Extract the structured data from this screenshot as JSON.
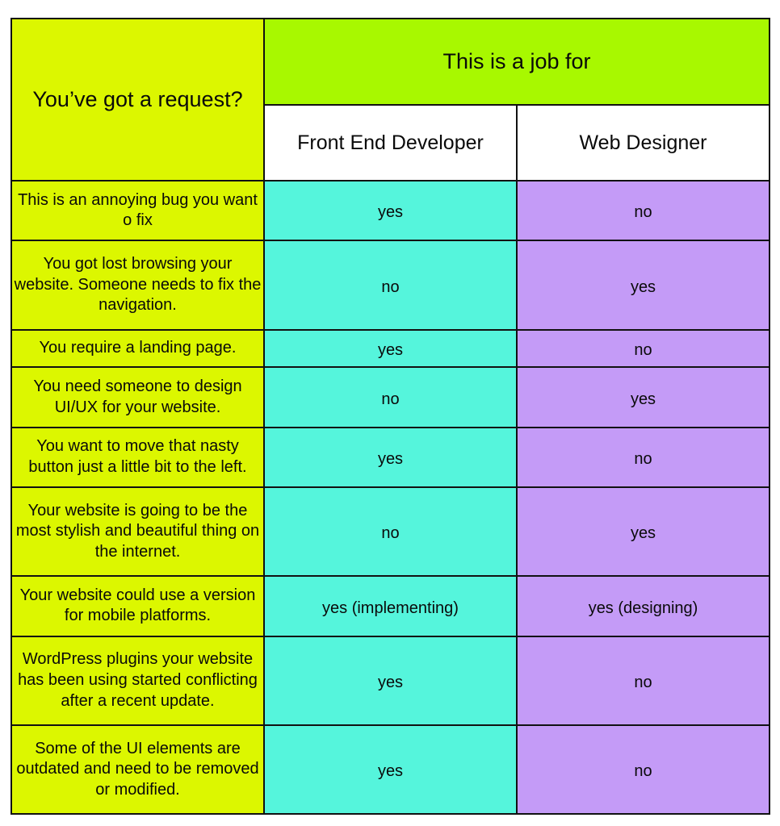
{
  "colors": {
    "request_header_bg": "#DCF700",
    "jobfor_header_bg": "#A8F800",
    "role_header_bg": "#FFFFFF",
    "request_cell_bg": "#DCF700",
    "front_end_cell_bg": "#55F5DC",
    "web_designer_cell_bg": "#C49BF7",
    "border": "#111111",
    "body_text": "#0A0A0A",
    "role_header_text": "#555555",
    "page_bg": "#FFFFFF"
  },
  "table": {
    "header": {
      "request_label": "You’ve got a request?",
      "group_label": "This is a job for",
      "columns": [
        "Front End Developer",
        "Web Designer"
      ]
    },
    "rows": [
      {
        "request": "This is an annoying bug you want o fix",
        "front_end": "yes",
        "web_designer": "no"
      },
      {
        "request": "You got lost browsing your website. Someone needs to fix the navigation.",
        "front_end": "no",
        "web_designer": "yes"
      },
      {
        "request": "You require a landing page.",
        "front_end": "yes",
        "web_designer": "no"
      },
      {
        "request": "You need someone to design UI/UX for your website.",
        "front_end": "no",
        "web_designer": "yes"
      },
      {
        "request": "You want to move that nasty button just a little bit to the left.",
        "front_end": "yes",
        "web_designer": "no"
      },
      {
        "request": "Your website is going to be the most stylish and beautiful thing on the internet.",
        "front_end": "no",
        "web_designer": "yes"
      },
      {
        "request": "Your website could use a version for mobile platforms.",
        "front_end": "yes (implementing)",
        "web_designer": "yes (designing)"
      },
      {
        "request": "WordPress plugins your website has been using started conflicting after a recent update.",
        "front_end": "yes",
        "web_designer": "no"
      },
      {
        "request": "Some of the UI elements are outdated and need to be removed or modified.",
        "front_end": "yes",
        "web_designer": "no"
      }
    ]
  }
}
